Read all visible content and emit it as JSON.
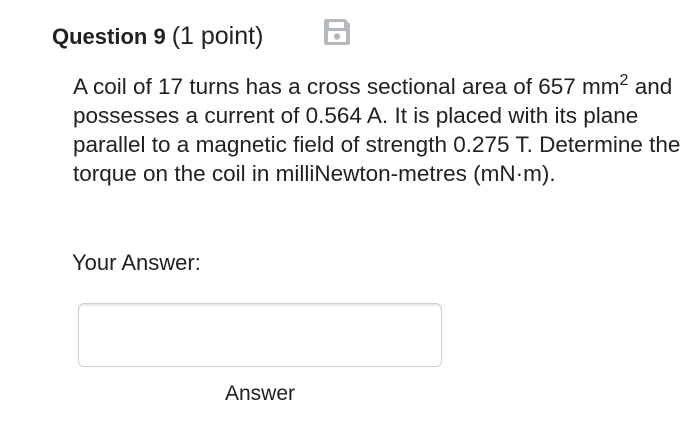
{
  "question": {
    "title": "Question 9",
    "points": "(1 point)",
    "icon": "save-icon",
    "text_before_sup": "A coil of 17 turns has a cross sectional area of 657 mm",
    "sup": "2",
    "text_after_sup": " and possesses a current of 0.564 A. It is placed with its plane parallel to a magnetic field of strength 0.275 T. Determine the torque on the coil in milliNewton-metres (mN·m)."
  },
  "answer": {
    "label": "Your Answer:",
    "value": "",
    "placeholder": "",
    "caption": "Answer"
  },
  "colors": {
    "text": "#202122",
    "icon": "#b4b9be",
    "input_border": "#cdd1d6"
  }
}
